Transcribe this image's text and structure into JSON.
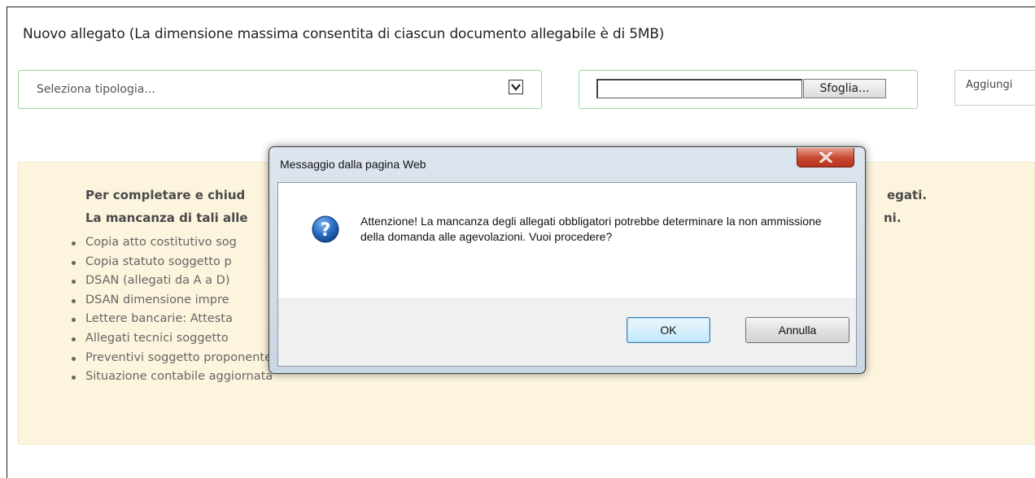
{
  "attachment": {
    "title": "Nuovo allegato (La dimensione massima consentita di ciascun documento allegabile è di 5MB)",
    "type_select_value": "Seleziona tipologia...",
    "file_value": "",
    "browse_label": "Sfoglia...",
    "add_label": "Aggiungi"
  },
  "notice": {
    "line1_left": "Per completare e chiud",
    "line1_right": "egati.",
    "line2_left": "La mancanza di tali alle",
    "line2_right": "ni.",
    "items": [
      "Copia atto costitutivo sog",
      "Copia statuto soggetto p",
      "DSAN (allegati da A a D)",
      "DSAN dimensione impre",
      "Lettere bancarie: Attesta",
      "Allegati tecnici soggetto",
      "Preventivi soggetto proponente",
      "Situazione contabile aggiornata"
    ]
  },
  "dialog": {
    "title": "Messaggio dalla pagina Web",
    "message": "Attenzione! La mancanza degli allegati obbligatori potrebbe determinare la non ammissione della domanda alle agevolazioni. Vuoi procedere?",
    "ok_label": "OK",
    "cancel_label": "Annulla"
  },
  "colors": {
    "field_border": "#9fd3a3",
    "notice_background": "#fcf4dd",
    "close_button": "#c8452c",
    "question_icon": "#1f5fae"
  },
  "icons": {
    "dropdown": "chevron-down-icon",
    "close": "close-icon",
    "question": "question-icon"
  }
}
